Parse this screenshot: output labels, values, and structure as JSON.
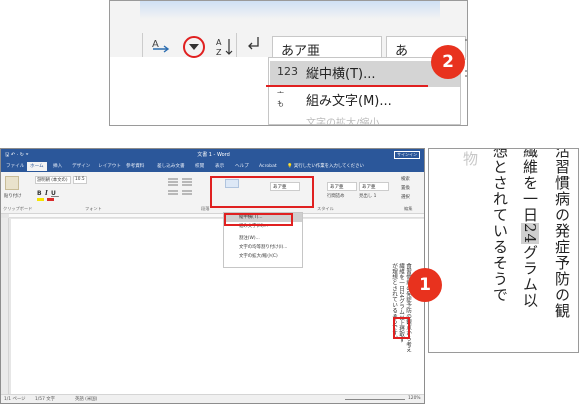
{
  "zoom_top": {
    "style_preview": "あア亜",
    "style_preview2": "あ",
    "dropdown_items": [
      {
        "icon": "123",
        "label": "縦中横(T)..."
      },
      {
        "icon": "組み",
        "label": "組み文字(M)..."
      }
    ],
    "faded_item": "文字の拡大/縮小",
    "badge": "2"
  },
  "word": {
    "title": "文書 1 - Word",
    "qat": "🖫 ↶ · ↻ ⏷",
    "sign_in": "サインイン",
    "tabs": [
      "ファイル",
      "ホーム",
      "挿入",
      "デザイン",
      "レイアウト",
      "参考資料",
      "差し込み文書",
      "校閲",
      "表示",
      "ヘルプ",
      "Acrobat"
    ],
    "tell_me": "💡 実行したい作業を入力してください",
    "font_name": "游明朝 (本文の)",
    "font_size": "10.5",
    "group_labels": [
      "クリップボード",
      "フォント",
      "段落",
      "スタイル",
      "編集"
    ],
    "paste": "貼り付け",
    "styles": [
      "あア亜",
      "あア亜",
      "あア亜"
    ],
    "style_names": [
      "標準",
      "行間詰め",
      "見出し 1"
    ],
    "editing": [
      "検索",
      "置換",
      "選択"
    ],
    "dropdown": [
      "縦中横(T)...",
      "組み文字(M)...",
      "割注(W)...",
      "文字の均等割り付け(I)...",
      "文字の拡大/縮小(C)"
    ],
    "doc_columns": [
      "食習慣病の発症予防の観点から考え",
      "繊維を一日24グラム以上摂取す",
      "が理想とされているそうです。"
    ],
    "status_left": "1/1 ページ",
    "status_words": "1/57 文字",
    "status_lang": "英語 (米国)",
    "zoom_level": "120%",
    "badge": "1"
  },
  "zoom_right": {
    "columns": [
      {
        "text": "活習慣病の発症予防の観",
        "grey": false
      },
      {
        "text": "繊維を一日24グラム以",
        "grey": false
      },
      {
        "text": "想とされているそうで",
        "grey": false
      },
      {
        "text": "物",
        "grey": true
      }
    ],
    "highlight": "24"
  }
}
